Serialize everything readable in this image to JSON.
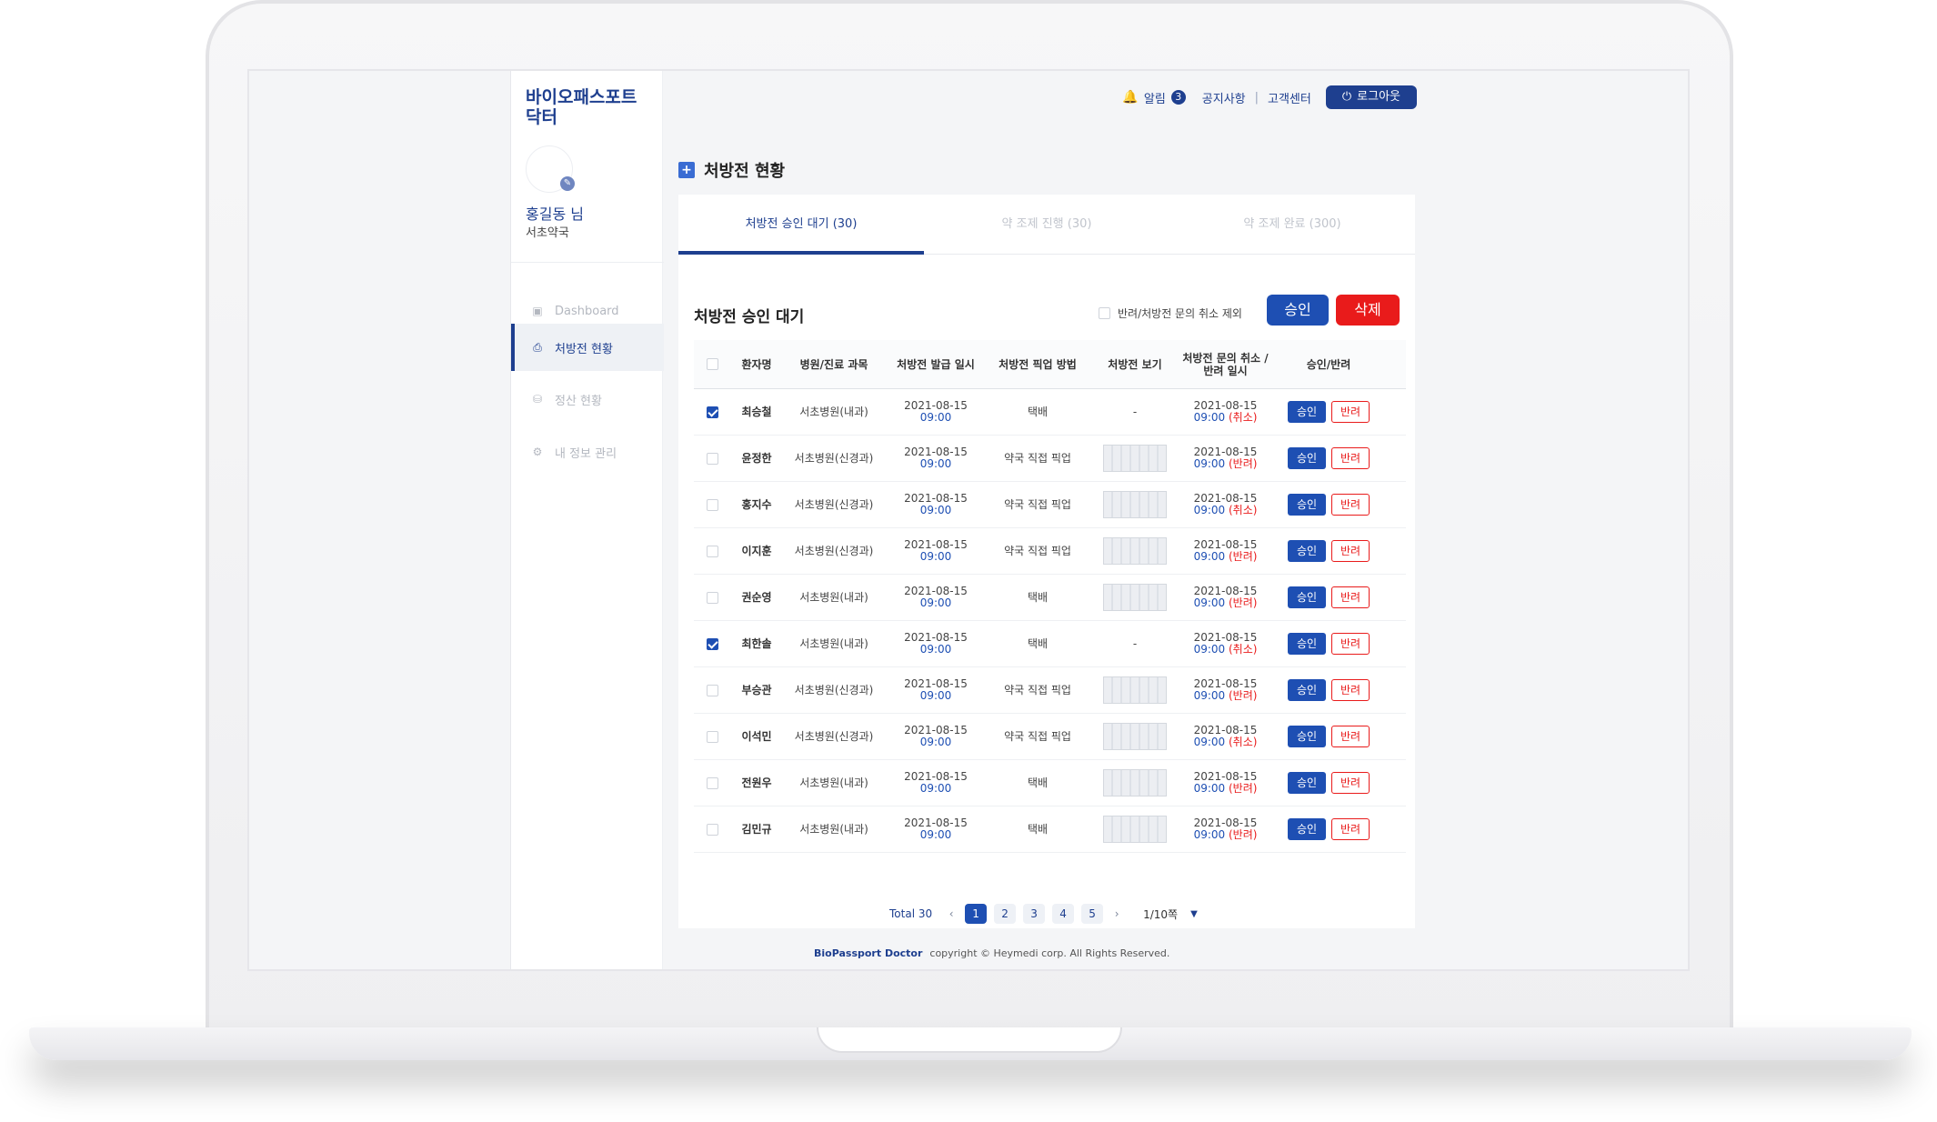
{
  "brand": "바이오패스포트 닥터",
  "user": {
    "name": "홍길동 님",
    "pharmacy": "서초약국"
  },
  "nav": [
    {
      "label": "Dashboard",
      "icon": "dashboard-icon"
    },
    {
      "label": "처방전 현황",
      "icon": "prescription-icon",
      "active": true
    },
    {
      "label": "정산 현황",
      "icon": "settlement-icon"
    },
    {
      "label": "내 정보 관리",
      "icon": "settings-icon"
    }
  ],
  "topbar": {
    "alarm_label": "알림",
    "alarm_count": "3",
    "notice": "공지사항",
    "separator": "|",
    "support": "고객센터",
    "logout": "로그아웃"
  },
  "page_title": "처방전 현황",
  "tabs": [
    "처방전 승인 대기 (30)",
    "약 조제 진행 (30)",
    "약 조제 완료 (300)"
  ],
  "section_title": "처방전 승인 대기",
  "exclude_label": "반려/처방전 문의 취소 제외",
  "buttons": {
    "approve_all": "승인",
    "delete_all": "삭제",
    "approve": "승인",
    "return": "반려"
  },
  "columns": [
    "환자명",
    "병원/진료 과목",
    "처방전 발급 일시",
    "처방전 픽업 방법",
    "처방전 보기",
    "처방전 문의 취소 /반려 일시",
    "승인/반려"
  ],
  "rows": [
    {
      "checked": true,
      "name": "최승철",
      "hospital": "서초병원(내과)",
      "date": "2021-08-15",
      "time": "09:00",
      "pickup": "택배",
      "view": "-",
      "cdate": "2021-08-15",
      "ctime": "09:00",
      "cstatus": "(취소)"
    },
    {
      "checked": false,
      "name": "윤정한",
      "hospital": "서초병원(신경과)",
      "date": "2021-08-15",
      "time": "09:00",
      "pickup": "약국 직접 픽업",
      "view": "thumb",
      "cdate": "2021-08-15",
      "ctime": "09:00",
      "cstatus": "(반려)"
    },
    {
      "checked": false,
      "name": "홍지수",
      "hospital": "서초병원(신경과)",
      "date": "2021-08-15",
      "time": "09:00",
      "pickup": "약국 직접 픽업",
      "view": "thumb",
      "cdate": "2021-08-15",
      "ctime": "09:00",
      "cstatus": "(취소)"
    },
    {
      "checked": false,
      "name": "이지훈",
      "hospital": "서초병원(신경과)",
      "date": "2021-08-15",
      "time": "09:00",
      "pickup": "약국 직접 픽업",
      "view": "thumb",
      "cdate": "2021-08-15",
      "ctime": "09:00",
      "cstatus": "(반려)"
    },
    {
      "checked": false,
      "name": "권순영",
      "hospital": "서초병원(내과)",
      "date": "2021-08-15",
      "time": "09:00",
      "pickup": "택배",
      "view": "thumb",
      "cdate": "2021-08-15",
      "ctime": "09:00",
      "cstatus": "(반려)"
    },
    {
      "checked": true,
      "name": "최한솔",
      "hospital": "서초병원(내과)",
      "date": "2021-08-15",
      "time": "09:00",
      "pickup": "택배",
      "view": "-",
      "cdate": "2021-08-15",
      "ctime": "09:00",
      "cstatus": "(취소)"
    },
    {
      "checked": false,
      "name": "부승관",
      "hospital": "서초병원(신경과)",
      "date": "2021-08-15",
      "time": "09:00",
      "pickup": "약국 직접 픽업",
      "view": "thumb",
      "cdate": "2021-08-15",
      "ctime": "09:00",
      "cstatus": "(반려)"
    },
    {
      "checked": false,
      "name": "이석민",
      "hospital": "서초병원(신경과)",
      "date": "2021-08-15",
      "time": "09:00",
      "pickup": "약국 직접 픽업",
      "view": "thumb",
      "cdate": "2021-08-15",
      "ctime": "09:00",
      "cstatus": "(취소)"
    },
    {
      "checked": false,
      "name": "전원우",
      "hospital": "서초병원(내과)",
      "date": "2021-08-15",
      "time": "09:00",
      "pickup": "택배",
      "view": "thumb",
      "cdate": "2021-08-15",
      "ctime": "09:00",
      "cstatus": "(반려)"
    },
    {
      "checked": false,
      "name": "김민규",
      "hospital": "서초병원(내과)",
      "date": "2021-08-15",
      "time": "09:00",
      "pickup": "택배",
      "view": "thumb",
      "cdate": "2021-08-15",
      "ctime": "09:00",
      "cstatus": "(반려)"
    }
  ],
  "pagination": {
    "total": "Total 30",
    "pages": [
      "1",
      "2",
      "3",
      "4",
      "5"
    ],
    "current": "1",
    "page_size": "1/10쪽"
  },
  "footer": {
    "brand": "BioPassport Doctor",
    "copyright": "copyright © Heymedi corp. All Rights Reserved."
  },
  "colors": {
    "primary": "#1e4fb3",
    "navy": "#1e3f8f",
    "danger": "#e91b1b"
  }
}
